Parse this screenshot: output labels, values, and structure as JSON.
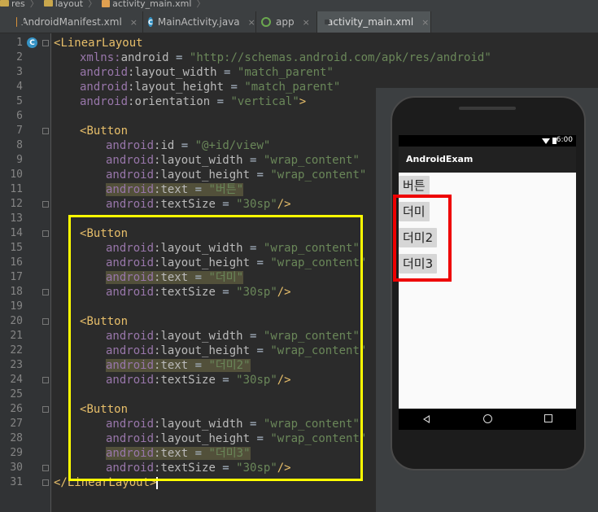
{
  "breadcrumb": [
    "res",
    "layout",
    "activity_main.xml"
  ],
  "tabs": [
    {
      "label": "AndroidManifest.xml",
      "icon": "xml-file-icon"
    },
    {
      "label": "MainActivity.java",
      "icon": "java-class-icon"
    },
    {
      "label": "app",
      "icon": "app-module-icon"
    },
    {
      "label": "activity_main.xml",
      "icon": "xml-file-icon",
      "active": true
    }
  ],
  "tab_close": "×",
  "gutter_marker": "C",
  "line_numbers": [
    "1",
    "2",
    "3",
    "4",
    "5",
    "6",
    "7",
    "8",
    "9",
    "10",
    "11",
    "12",
    "13",
    "14",
    "15",
    "16",
    "17",
    "18",
    "19",
    "20",
    "21",
    "22",
    "23",
    "24",
    "25",
    "26",
    "27",
    "28",
    "29",
    "30",
    "31"
  ],
  "code": {
    "l1": {
      "open": "<",
      "tag": "LinearLayout"
    },
    "l2": {
      "ns": "xmlns:",
      "attr": "android",
      "eq": " = ",
      "val": "\"http://schemas.android.com/apk/res/android\""
    },
    "l3": {
      "ns": "android",
      "attr": ":layout_width",
      "eq": " = ",
      "val": "\"match_parent\""
    },
    "l4": {
      "ns": "android",
      "attr": ":layout_height",
      "eq": " = ",
      "val": "\"match_parent\""
    },
    "l5": {
      "ns": "android",
      "attr": ":orientation",
      "eq": " = ",
      "val": "\"vertical\"",
      "close": ">"
    },
    "l7": {
      "open": "<",
      "tag": "Button"
    },
    "l8": {
      "ns": "android",
      "attr": ":id",
      "eq": " = ",
      "val": "\"@+id/view\""
    },
    "l9": {
      "ns": "android",
      "attr": ":layout_width",
      "eq": " = ",
      "val": "\"wrap_content\""
    },
    "l10": {
      "ns": "android",
      "attr": ":layout_height",
      "eq": " = ",
      "val": "\"wrap_content\""
    },
    "l11": {
      "ns": "android",
      "attr": ":text",
      "eq": " = ",
      "val": "\"버튼\""
    },
    "l12": {
      "ns": "android",
      "attr": ":textSize",
      "eq": " = ",
      "val": "\"30sp\"",
      "close": "/>"
    },
    "l14": {
      "open": "<",
      "tag": "Button"
    },
    "l15": {
      "ns": "android",
      "attr": ":layout_width",
      "eq": " = ",
      "val": "\"wrap_content\""
    },
    "l16": {
      "ns": "android",
      "attr": ":layout_height",
      "eq": " = ",
      "val": "\"wrap_content\""
    },
    "l17": {
      "ns": "android",
      "attr": ":text",
      "eq": " = ",
      "val": "\"더미\""
    },
    "l18": {
      "ns": "android",
      "attr": ":textSize",
      "eq": " = ",
      "val": "\"30sp\"",
      "close": "/>"
    },
    "l20": {
      "open": "<",
      "tag": "Button"
    },
    "l21": {
      "ns": "android",
      "attr": ":layout_width",
      "eq": " = ",
      "val": "\"wrap_content\""
    },
    "l22": {
      "ns": "android",
      "attr": ":layout_height",
      "eq": " = ",
      "val": "\"wrap_content\""
    },
    "l23": {
      "ns": "android",
      "attr": ":text",
      "eq": " = ",
      "val": "\"더미2\""
    },
    "l24": {
      "ns": "android",
      "attr": ":textSize",
      "eq": " = ",
      "val": "\"30sp\"",
      "close": "/>"
    },
    "l26": {
      "open": "<",
      "tag": "Button"
    },
    "l27": {
      "ns": "android",
      "attr": ":layout_width",
      "eq": " = ",
      "val": "\"wrap_content\""
    },
    "l28": {
      "ns": "android",
      "attr": ":layout_height",
      "eq": " = ",
      "val": "\"wrap_content\""
    },
    "l29": {
      "ns": "android",
      "attr": ":text",
      "eq": " = ",
      "val": "\"더미3\""
    },
    "l30": {
      "ns": "android",
      "attr": ":textSize",
      "eq": " = ",
      "val": "\"30sp\"",
      "close": "/>"
    },
    "l31": {
      "open": "</",
      "tag": "LinearLayout",
      "close": ">"
    }
  },
  "preview": {
    "status_time": "6:00",
    "app_title": "AndroidExam",
    "buttons": [
      "버튼",
      "더미",
      "더미2",
      "더미3"
    ]
  },
  "colors": {
    "highlight_yellow": "#ffff00",
    "highlight_red": "#ee0000",
    "xml_tag": "#e8bf6a",
    "xml_namespace": "#9876aa",
    "xml_string": "#6a8759"
  }
}
